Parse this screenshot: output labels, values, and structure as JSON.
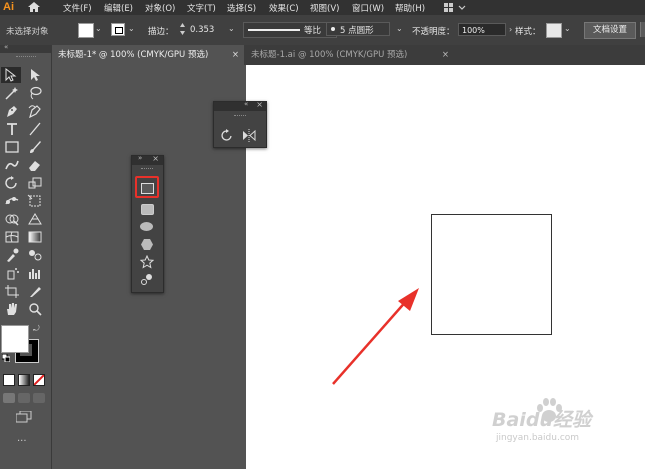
{
  "app": {
    "logo": "Ai"
  },
  "menu": [
    "文件(F)",
    "编辑(E)",
    "对象(O)",
    "文字(T)",
    "选择(S)",
    "效果(C)",
    "视图(V)",
    "窗口(W)",
    "帮助(H)"
  ],
  "control_bar": {
    "selection_status": "未选择对象",
    "stroke_label": "描边：",
    "stroke_value": "0.353",
    "stroke_profile": "等比",
    "brush_value": "5 点圆形",
    "opacity_label": "不透明度：",
    "opacity_value": "100%",
    "style_label": "样式：",
    "doc_setup_button": "文档设置"
  },
  "tabs": [
    {
      "label": "未标题-1* @ 100% (CMYK/GPU 预选)",
      "active": true,
      "close": "×"
    },
    {
      "label": "未标题-1.ai @ 100% (CMYK/GPU 预选)",
      "active": false,
      "close": "×"
    }
  ],
  "toolbox": {
    "fill_color": "#ffffff",
    "stroke_color": "#000000",
    "more_label": "..."
  },
  "shape_panel": {
    "tools": [
      "rectangle-tool",
      "rounded-rectangle-tool",
      "ellipse-tool",
      "polygon-tool",
      "star-tool",
      "flare-tool"
    ],
    "highlighted": "rectangle-tool",
    "highlight_color": "#e8312a"
  },
  "rotate_panel": {
    "tools": [
      "rotate-tool",
      "reflect-tool"
    ]
  },
  "artboard": {
    "background": "#ffffff",
    "shape": "rectangle",
    "shape_stroke": "#333333"
  },
  "annotation": {
    "arrow_color": "#e8312a"
  },
  "watermark": {
    "brand": "Baidu经验",
    "url": "jingyan.baidu.com"
  }
}
